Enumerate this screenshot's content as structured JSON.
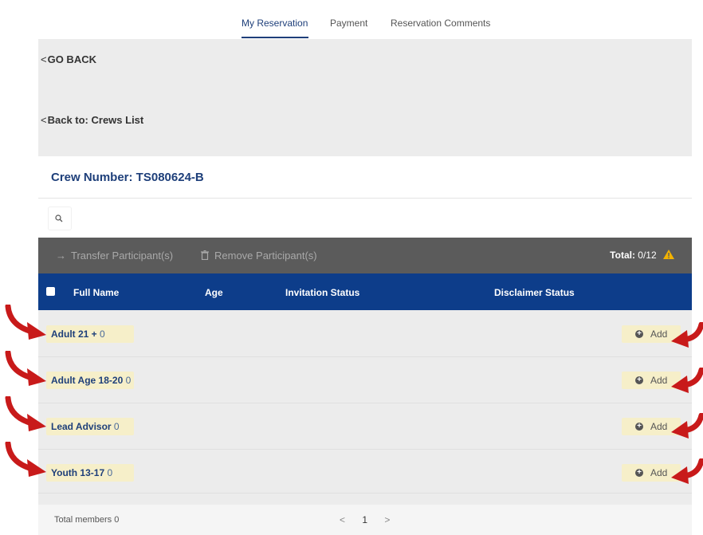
{
  "tabs": [
    {
      "label": "My Reservation",
      "active": true
    },
    {
      "label": "Payment",
      "active": false
    },
    {
      "label": "Reservation Comments",
      "active": false
    }
  ],
  "nav": {
    "go_back": "GO BACK",
    "back_to_crews": "Back to: Crews List"
  },
  "crew": {
    "title": "Crew Number: TS080624-B"
  },
  "toolbar": {
    "transfer_label": "Transfer Participant(s)",
    "remove_label": "Remove Participant(s)",
    "total_label": "Total:",
    "total_value": "0/12"
  },
  "table": {
    "headers": {
      "full_name": "Full Name",
      "age": "Age",
      "invitation_status": "Invitation Status",
      "disclaimer_status": "Disclaimer Status"
    },
    "rows": [
      {
        "label": "Adult 21 +",
        "count": "0"
      },
      {
        "label": "Adult Age 18-20",
        "count": "0"
      },
      {
        "label": "Lead Advisor",
        "count": "0"
      },
      {
        "label": "Youth 13-17",
        "count": "0"
      }
    ],
    "add_label": "Add"
  },
  "footer": {
    "total_members": "Total members 0",
    "prev": "<",
    "page": "1",
    "next": ">"
  },
  "colors": {
    "brand_blue": "#0d3d8a",
    "label_bg": "#f6efc9",
    "warning": "#f2b200",
    "annotation_arrow": "#c81a1a"
  }
}
